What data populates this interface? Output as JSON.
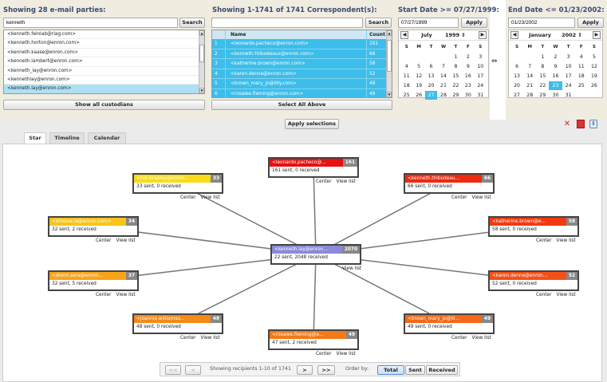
{
  "parties": {
    "title": "Showing 28 e-mail parties:",
    "search_value": "kenneth",
    "search_btn": "Search",
    "items": [
      "<kenneth.feinlab@rlag.com>",
      "<kenneth.horton@enron.com>",
      "<kenneth.kaase@enron.com>",
      "<kenneth.lambert@enron.com>",
      "<kenneth_lay@enron.com>",
      "<kennethlay@enron.com>",
      "<kenneth.lay@enron.com>",
      "<kenneth.lay@enron.net>"
    ],
    "selected_index": 6,
    "footer_btn": "Show all custodians"
  },
  "corr": {
    "title": "Showing 1-1741 of 1741 Correspondent(s):",
    "search_value": "",
    "search_btn": "Search",
    "headers": {
      "idx": "",
      "name": "Name",
      "count": "Count"
    },
    "rows": [
      [
        "1",
        "<leonardo.pacheco@enron.com>",
        "161"
      ],
      [
        "2",
        "<kenneth.thibodeaux@enron.com>",
        "66"
      ],
      [
        "3",
        "<katherine.brown@enron.com>",
        "58"
      ],
      [
        "4",
        "<karen.denne@enron.com>",
        "52"
      ],
      [
        "5",
        "<brown_mary_jo@lilly.com>",
        "49"
      ],
      [
        "6",
        "<rosalee.fleming@enron.com>",
        "49"
      ]
    ],
    "footer_btn": "Select All Above"
  },
  "start": {
    "title": "Start Date >= 07/27/1999:",
    "value": "07/27/1999",
    "apply": "Apply",
    "month": "July",
    "year": "1999 ⇕",
    "highlight": "27"
  },
  "end": {
    "title": "End Date <= 01/23/2002:",
    "value": "01/23/2002",
    "apply": "Apply",
    "month": "January",
    "year": "2002 ⇕",
    "highlight": "23"
  },
  "weekdays": [
    "S",
    "M",
    "T",
    "W",
    "T",
    "F",
    "S"
  ],
  "start_days": [
    [
      "",
      "",
      "",
      "",
      "1",
      "2",
      "3"
    ],
    [
      "4",
      "5",
      "6",
      "7",
      "8",
      "9",
      "10"
    ],
    [
      "11",
      "12",
      "13",
      "14",
      "15",
      "16",
      "17"
    ],
    [
      "18",
      "19",
      "20",
      "21",
      "22",
      "23",
      "24"
    ],
    [
      "25",
      "26",
      "27",
      "28",
      "29",
      "30",
      "31"
    ]
  ],
  "end_days": [
    [
      "",
      "",
      "1",
      "2",
      "3",
      "4",
      "5"
    ],
    [
      "6",
      "7",
      "8",
      "9",
      "10",
      "11",
      "12"
    ],
    [
      "13",
      "14",
      "15",
      "16",
      "17",
      "18",
      "19"
    ],
    [
      "20",
      "21",
      "22",
      "23",
      "24",
      "25",
      "26"
    ],
    [
      "27",
      "28",
      "29",
      "30",
      "31",
      "",
      ""
    ]
  ],
  "link_symbol": "⇔",
  "apply_selections": "Apply selections",
  "tabs": [
    "Star",
    "Timeline",
    "Calendar"
  ],
  "center_label": "Center",
  "view_label": "View list",
  "center": {
    "name": "<kenneth.lay@enron...",
    "count": "2070",
    "stats": "22 sent, 2048 received",
    "color": "#8a8ad8"
  },
  "nodes": [
    {
      "name": "<leonardo.pacheco@...",
      "count": "161",
      "stats": "161 sent, 0 received",
      "color": "#e81010"
    },
    {
      "name": "<kenneth.thibodeau...",
      "count": "66",
      "stats": "66 sent, 0 received",
      "color": "#ee2a10"
    },
    {
      "name": "<katherine.brown@e...",
      "count": "58",
      "stats": "58 sent, 0 received",
      "color": "#f23a10"
    },
    {
      "name": "<karen.denne@enron...",
      "count": "52",
      "stats": "52 sent, 0 received",
      "color": "#f25018"
    },
    {
      "name": "<brown_mary_jo@lil...",
      "count": "49",
      "stats": "49 sent, 0 received",
      "color": "#f46818"
    },
    {
      "name": "<rosalee.fleming@e...",
      "count": "49",
      "stats": "47 sent, 2 received",
      "color": "#f47a18"
    },
    {
      "name": "<joannie.williamso...",
      "count": "48",
      "stats": "48 sent, 0 received",
      "color": "#f48a18"
    },
    {
      "name": "<sherri.sera@enron...",
      "count": "37",
      "stats": "32 sent, 5 received",
      "color": "#f8a418"
    },
    {
      "name": "<simone.la@enron.com>",
      "count": "34",
      "stats": "32 sent, 2 received",
      "color": "#f8c418"
    },
    {
      "name": "<rob.bradley@enron...",
      "count": "33",
      "stats": "33 sent, 0 received",
      "color": "#f8dc18"
    }
  ],
  "pager": {
    "first": "<<",
    "prev": "<",
    "status": "Showing recipients 1-10 of 1741",
    "next": ">",
    "last": ">>",
    "order_label": "Order by:",
    "orders": [
      "Total",
      "Sent",
      "Received"
    ],
    "active_order": "Total"
  }
}
